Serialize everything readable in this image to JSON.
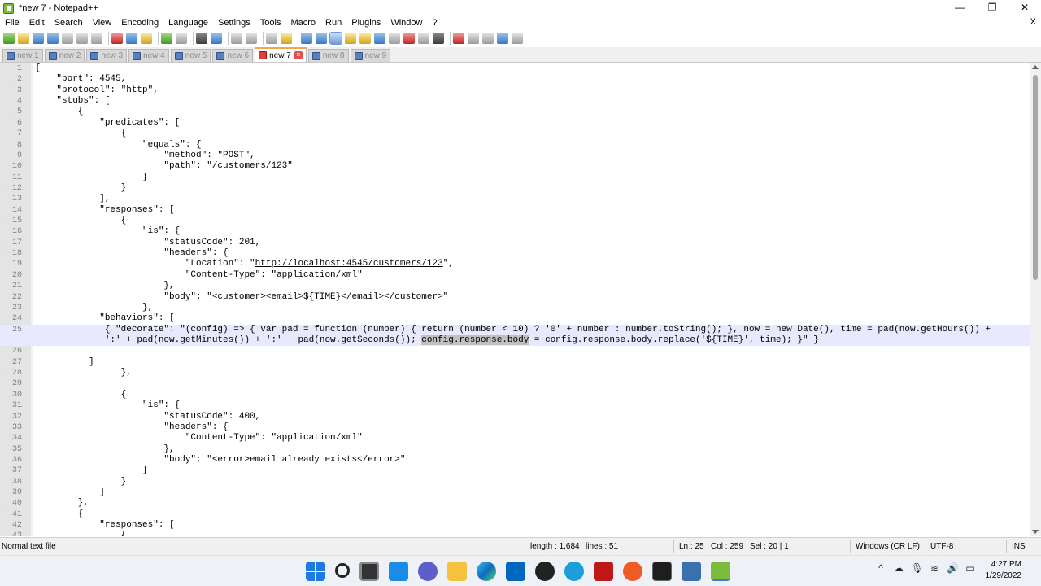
{
  "window": {
    "title": "*new 7 - Notepad++",
    "minimize": "—",
    "restore": "❐",
    "close": "✕"
  },
  "menu": {
    "items": [
      "File",
      "Edit",
      "Search",
      "View",
      "Encoding",
      "Language",
      "Settings",
      "Tools",
      "Macro",
      "Run",
      "Plugins",
      "Window",
      "?"
    ],
    "close_doc": "X"
  },
  "tabs": [
    {
      "label": "new 1",
      "active": false
    },
    {
      "label": "new 2",
      "active": false
    },
    {
      "label": "new 3",
      "active": false
    },
    {
      "label": "new 4",
      "active": false
    },
    {
      "label": "new 5",
      "active": false
    },
    {
      "label": "new 6",
      "active": false
    },
    {
      "label": "new 7",
      "active": true
    },
    {
      "label": "new 8",
      "active": false
    },
    {
      "label": "new 9",
      "active": false
    }
  ],
  "tab_close_glyph": "×",
  "editor": {
    "lines": [
      {
        "num": "1",
        "text": "{"
      },
      {
        "num": "2",
        "text": "    \"port\": 4545,"
      },
      {
        "num": "3",
        "text": "    \"protocol\": \"http\","
      },
      {
        "num": "4",
        "text": "    \"stubs\": ["
      },
      {
        "num": "5",
        "text": "        {"
      },
      {
        "num": "6",
        "text": "            \"predicates\": ["
      },
      {
        "num": "7",
        "text": "                {"
      },
      {
        "num": "8",
        "text": "                    \"equals\": {"
      },
      {
        "num": "9",
        "text": "                        \"method\": \"POST\","
      },
      {
        "num": "10",
        "text": "                        \"path\": \"/customers/123\""
      },
      {
        "num": "11",
        "text": "                    }"
      },
      {
        "num": "12",
        "text": "                }"
      },
      {
        "num": "13",
        "text": "            ],"
      },
      {
        "num": "14",
        "text": "            \"responses\": ["
      },
      {
        "num": "15",
        "text": "                {"
      },
      {
        "num": "16",
        "text": "                    \"is\": {"
      },
      {
        "num": "17",
        "text": "                        \"statusCode\": 201,"
      },
      {
        "num": "18",
        "text": "                        \"headers\": {"
      },
      {
        "num": "19",
        "text": "                            \"Location\": \"",
        "link": "http://localhost:4545/customers/123",
        "after": "\","
      },
      {
        "num": "20",
        "text": "                            \"Content-Type\": \"application/xml\""
      },
      {
        "num": "21",
        "text": "                        },"
      },
      {
        "num": "22",
        "text": "                        \"body\": \"<customer><email>${TIME}</email></customer>\""
      },
      {
        "num": "23",
        "text": "                    },"
      },
      {
        "num": "24",
        "text": "            \"behaviors\": ["
      },
      {
        "num": "25",
        "text": "             { \"decorate\": \"(config) => { var pad = function (number) { return (number < 10) ? '0' + number : number.toString(); }, now = new Date(), time = pad(now.getHours()) +",
        "current": true
      },
      {
        "num": "",
        "text": "             ':' + pad(now.getMinutes()) + ':' + pad(now.getSeconds()); ",
        "sel": "config.response.body",
        "after": " = config.response.body.replace('${TIME}', time); }\" }",
        "current": true
      },
      {
        "num": "26",
        "text": ""
      },
      {
        "num": "27",
        "text": "          ]"
      },
      {
        "num": "28",
        "text": "                },"
      },
      {
        "num": "29",
        "text": ""
      },
      {
        "num": "30",
        "text": "                {"
      },
      {
        "num": "31",
        "text": "                    \"is\": {"
      },
      {
        "num": "32",
        "text": "                        \"statusCode\": 400,"
      },
      {
        "num": "33",
        "text": "                        \"headers\": {"
      },
      {
        "num": "34",
        "text": "                            \"Content-Type\": \"application/xml\""
      },
      {
        "num": "35",
        "text": "                        },"
      },
      {
        "num": "36",
        "text": "                        \"body\": \"<error>email already exists</error>\""
      },
      {
        "num": "37",
        "text": "                    }"
      },
      {
        "num": "38",
        "text": "                }"
      },
      {
        "num": "39",
        "text": "            ]"
      },
      {
        "num": "40",
        "text": "        },"
      },
      {
        "num": "41",
        "text": "        {"
      },
      {
        "num": "42",
        "text": "            \"responses\": ["
      },
      {
        "num": "43",
        "text": "                {"
      }
    ]
  },
  "status": {
    "file_type": "Normal text file",
    "length": "length : 1,684",
    "lines": "lines : 51",
    "ln": "Ln : 25",
    "col": "Col : 259",
    "sel": "Sel : 20 | 1",
    "eol": "Windows (CR LF)",
    "encoding": "UTF-8",
    "mode": "INS"
  },
  "taskbar": {
    "time": "4:27 PM",
    "date": "1/29/2022",
    "icons": [
      "start-icon",
      "search-icon",
      "task-view-icon",
      "widgets-icon",
      "teams-chat-icon",
      "file-explorer-icon",
      "edge-icon",
      "store-icon",
      "github-icon",
      "help-icon",
      "mcafee-icon",
      "postman-icon",
      "terminal-icon",
      "calculator-icon",
      "notepadpp-icon"
    ],
    "tray": {
      "chevron": "^",
      "onedrive": "☁",
      "mic": "🎙",
      "wifi": "≋",
      "volume": "🔊",
      "battery": "▭"
    }
  },
  "colors": {
    "current_line": "#e8e8ff",
    "selection": "#c0c0c0",
    "active_tab_accent": "#f4a64c",
    "gutter": "#e4e4e4"
  }
}
